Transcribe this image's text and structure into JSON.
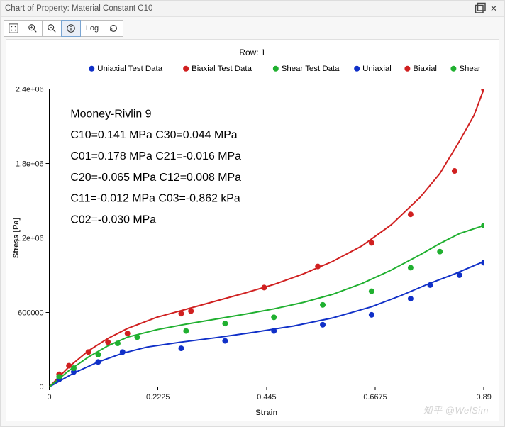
{
  "window": {
    "title": "Chart of Property: Material Constant C10",
    "row_label": "Row: 1"
  },
  "toolbar": {
    "zoom_fit": "Zoom to fit",
    "zoom_in": "Zoom in",
    "zoom_out": "Zoom out",
    "info": "Data info",
    "log": "Log",
    "reload": "Reload"
  },
  "annotation": {
    "title": "Mooney-Rivlin 9",
    "lines": [
      "C10=0.141 MPa   C30=0.044 MPa",
      "C01=0.178 MPa   C21=-0.016 MPa",
      "C20=-0.065 MPa  C12=0.008 MPa",
      "C11=-0.012 MPa  C03=-0.862 kPa",
      "C02=-0.030 MPa"
    ]
  },
  "watermark": "知乎 @WelSim",
  "chart_data": {
    "type": "scatter+line",
    "title": "Row: 1",
    "xlabel": "Strain",
    "ylabel": "Stress [Pa]",
    "xlim": [
      0,
      0.89
    ],
    "ylim": [
      0,
      2400000
    ],
    "xticks": [
      0,
      0.2225,
      0.445,
      0.6675,
      0.89
    ],
    "yticks": [
      0,
      600000,
      1200000,
      1800000,
      2400000
    ],
    "ytick_labels": [
      "0",
      "600000",
      "1.2e+06",
      "1.8e+06",
      "2.4e+06"
    ],
    "legend": [
      {
        "name": "Uniaxial Test Data",
        "type": "scatter",
        "color": "#1030c8"
      },
      {
        "name": "Biaxial Test Data",
        "type": "scatter",
        "color": "#d02020"
      },
      {
        "name": "Shear Test Data",
        "type": "scatter",
        "color": "#20b030"
      },
      {
        "name": "Uniaxial",
        "type": "line",
        "color": "#1030c8"
      },
      {
        "name": "Biaxial",
        "type": "line",
        "color": "#d02020"
      },
      {
        "name": "Shear",
        "type": "line",
        "color": "#20b030"
      }
    ],
    "series": [
      {
        "name": "Uniaxial Test Data",
        "type": "scatter",
        "color": "#1030c8",
        "points": [
          [
            0.02,
            60000
          ],
          [
            0.05,
            120000
          ],
          [
            0.1,
            200000
          ],
          [
            0.15,
            280000
          ],
          [
            0.27,
            310000
          ],
          [
            0.36,
            370000
          ],
          [
            0.46,
            450000
          ],
          [
            0.56,
            500000
          ],
          [
            0.66,
            580000
          ],
          [
            0.74,
            710000
          ],
          [
            0.78,
            820000
          ],
          [
            0.84,
            900000
          ],
          [
            0.89,
            1000000
          ]
        ]
      },
      {
        "name": "Biaxial Test Data",
        "type": "scatter",
        "color": "#d02020",
        "points": [
          [
            0.02,
            100000
          ],
          [
            0.04,
            170000
          ],
          [
            0.08,
            280000
          ],
          [
            0.12,
            360000
          ],
          [
            0.16,
            430000
          ],
          [
            0.27,
            590000
          ],
          [
            0.29,
            610000
          ],
          [
            0.44,
            800000
          ],
          [
            0.55,
            970000
          ],
          [
            0.66,
            1160000
          ],
          [
            0.74,
            1390000
          ],
          [
            0.83,
            1740000
          ],
          [
            0.89,
            2400000
          ]
        ]
      },
      {
        "name": "Shear Test Data",
        "type": "scatter",
        "color": "#20b030",
        "points": [
          [
            0.02,
            80000
          ],
          [
            0.05,
            150000
          ],
          [
            0.1,
            260000
          ],
          [
            0.14,
            350000
          ],
          [
            0.18,
            400000
          ],
          [
            0.28,
            450000
          ],
          [
            0.36,
            510000
          ],
          [
            0.46,
            560000
          ],
          [
            0.56,
            660000
          ],
          [
            0.66,
            770000
          ],
          [
            0.74,
            960000
          ],
          [
            0.8,
            1090000
          ],
          [
            0.89,
            1300000
          ]
        ]
      },
      {
        "name": "Uniaxial",
        "type": "line",
        "color": "#1030c8",
        "points": [
          [
            0,
            0
          ],
          [
            0.05,
            110000
          ],
          [
            0.1,
            200000
          ],
          [
            0.15,
            270000
          ],
          [
            0.2,
            320000
          ],
          [
            0.27,
            360000
          ],
          [
            0.34,
            395000
          ],
          [
            0.42,
            440000
          ],
          [
            0.5,
            490000
          ],
          [
            0.58,
            555000
          ],
          [
            0.66,
            645000
          ],
          [
            0.72,
            735000
          ],
          [
            0.78,
            835000
          ],
          [
            0.83,
            910000
          ],
          [
            0.89,
            1010000
          ]
        ]
      },
      {
        "name": "Biaxial",
        "type": "line",
        "color": "#d02020",
        "points": [
          [
            0,
            0
          ],
          [
            0.04,
            160000
          ],
          [
            0.08,
            290000
          ],
          [
            0.12,
            390000
          ],
          [
            0.16,
            470000
          ],
          [
            0.22,
            560000
          ],
          [
            0.28,
            625000
          ],
          [
            0.34,
            690000
          ],
          [
            0.4,
            755000
          ],
          [
            0.46,
            825000
          ],
          [
            0.52,
            910000
          ],
          [
            0.58,
            1010000
          ],
          [
            0.64,
            1135000
          ],
          [
            0.7,
            1305000
          ],
          [
            0.76,
            1530000
          ],
          [
            0.8,
            1720000
          ],
          [
            0.84,
            1980000
          ],
          [
            0.87,
            2190000
          ],
          [
            0.89,
            2400000
          ]
        ]
      },
      {
        "name": "Shear",
        "type": "line",
        "color": "#20b030",
        "points": [
          [
            0,
            0
          ],
          [
            0.04,
            130000
          ],
          [
            0.08,
            240000
          ],
          [
            0.12,
            330000
          ],
          [
            0.16,
            400000
          ],
          [
            0.22,
            460000
          ],
          [
            0.28,
            505000
          ],
          [
            0.34,
            545000
          ],
          [
            0.4,
            585000
          ],
          [
            0.46,
            628000
          ],
          [
            0.52,
            680000
          ],
          [
            0.58,
            745000
          ],
          [
            0.64,
            832000
          ],
          [
            0.7,
            940000
          ],
          [
            0.76,
            1065000
          ],
          [
            0.8,
            1155000
          ],
          [
            0.84,
            1235000
          ],
          [
            0.89,
            1300000
          ]
        ]
      }
    ]
  }
}
